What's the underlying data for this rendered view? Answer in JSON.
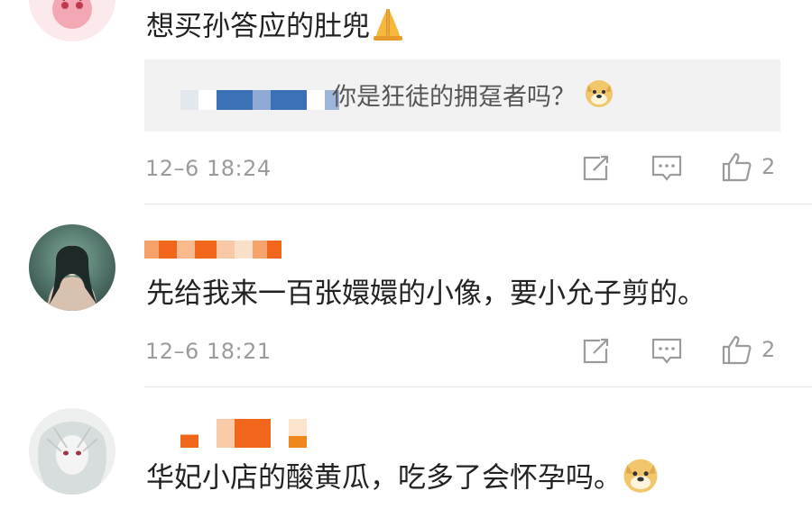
{
  "comments": [
    {
      "text": "想买孙答应的肚兜",
      "reply": {
        "text": "你是狂徒的拥趸者吗？"
      },
      "time": "12–6 18:24",
      "likes": "2"
    },
    {
      "text": "先给我来一百张嬛嬛的小像，要小允子剪的。",
      "time": "12–6 18:21",
      "likes": "2"
    },
    {
      "text": "华妃小店的酸黄瓜，吃多了会怀孕吗。"
    }
  ],
  "icons": {
    "share": "share-icon",
    "comment": "comment-icon",
    "like": "thumbs-up-icon",
    "pray": "pray-emoji-icon",
    "doge": "doge-emoji-icon"
  },
  "colors": {
    "meta_gray": "#9b9b9b",
    "reply_bg": "#f2f2f2",
    "username_orange": "#f5761f",
    "username_blue": "#3b6fb6"
  }
}
